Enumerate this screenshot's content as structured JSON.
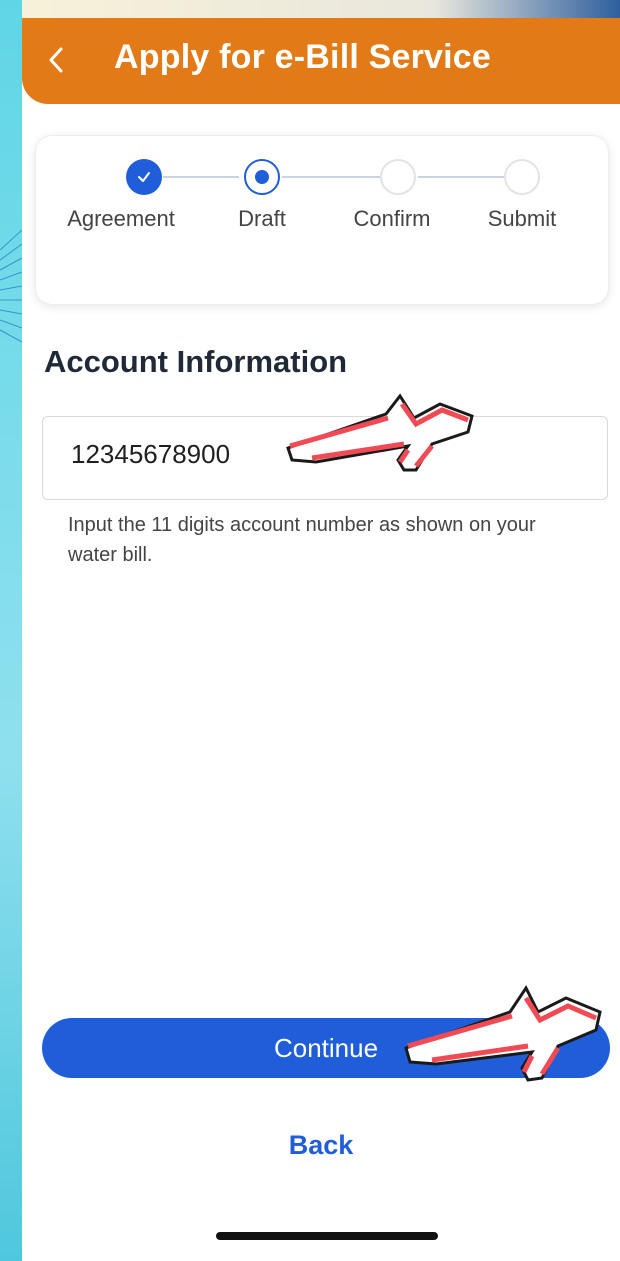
{
  "header": {
    "title": "Apply for e-Bill Service",
    "back_icon": "chevron-left-icon"
  },
  "stepper": {
    "steps": [
      {
        "label": "Agreement",
        "state": "done"
      },
      {
        "label": "Draft",
        "state": "current"
      },
      {
        "label": "Confirm",
        "state": "todo"
      },
      {
        "label": "Submit",
        "state": "todo"
      }
    ]
  },
  "account": {
    "section_title": "Account Information",
    "account_number_value": "12345678900",
    "helper_text": "Input the 11 digits account number as shown on your water bill."
  },
  "actions": {
    "continue_label": "Continue",
    "back_label": "Back"
  },
  "colors": {
    "header_orange": "#e27a17",
    "primary_blue": "#1f5ed8",
    "pointer_red": "#f04b55"
  }
}
